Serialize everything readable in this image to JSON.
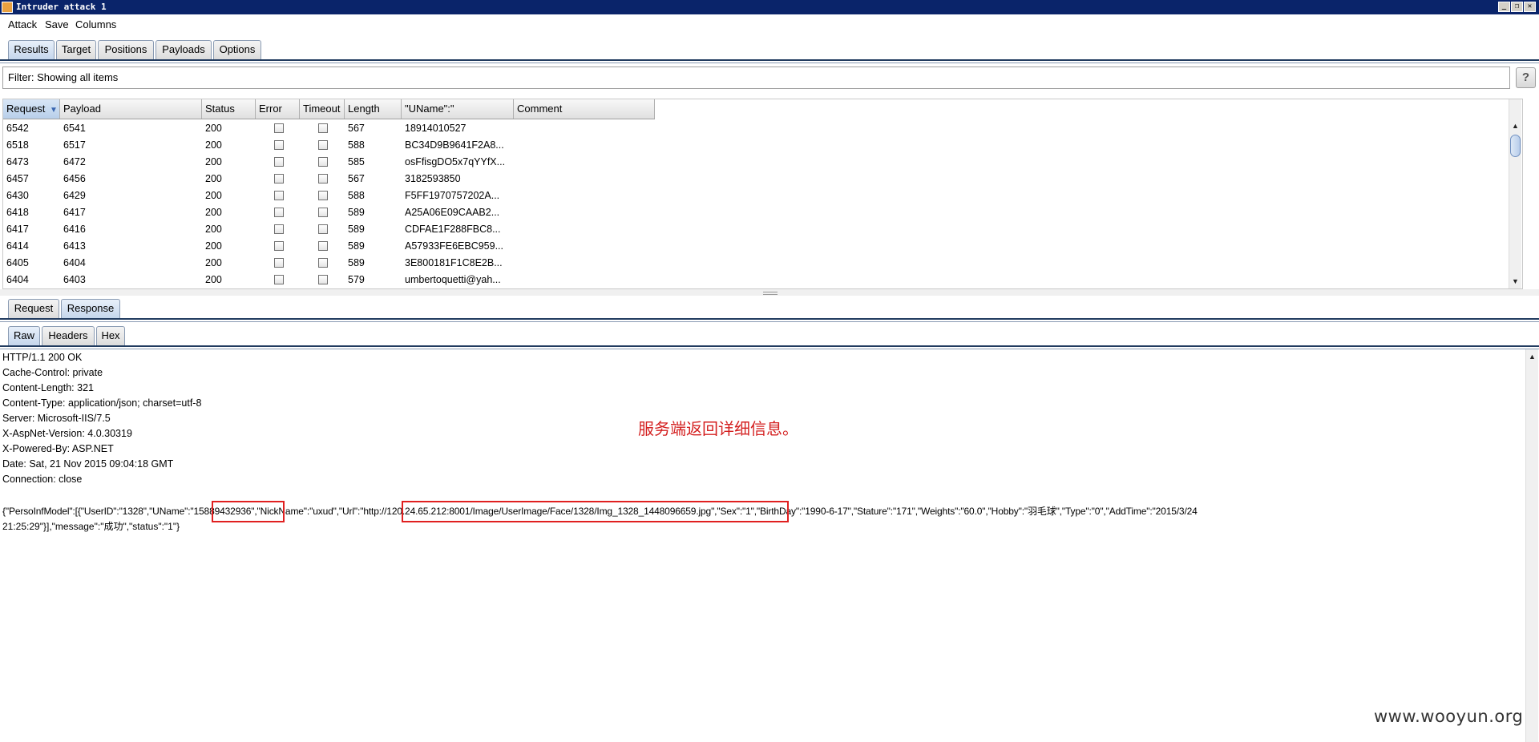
{
  "window": {
    "title": "Intruder attack 1",
    "controls": {
      "minimize": "_",
      "restore": "❐",
      "close": "✕"
    }
  },
  "menu": [
    "Attack",
    "Save",
    "Columns"
  ],
  "main_tabs": [
    "Results",
    "Target",
    "Positions",
    "Payloads",
    "Options"
  ],
  "filter": {
    "text": "Filter: Showing all items",
    "help": "?"
  },
  "table": {
    "columns": [
      "Request",
      "Payload",
      "Status",
      "Error",
      "Timeout",
      "Length",
      "\"UName\":\"",
      "Comment"
    ],
    "sort_indicator": "▼",
    "rows": [
      {
        "request": "6542",
        "payload": "6541",
        "status": "200",
        "length": "567",
        "uname": "18914010527"
      },
      {
        "request": "6518",
        "payload": "6517",
        "status": "200",
        "length": "588",
        "uname": "BC34D9B9641F2A8..."
      },
      {
        "request": "6473",
        "payload": "6472",
        "status": "200",
        "length": "585",
        "uname": "osFfisgDO5x7qYYfX..."
      },
      {
        "request": "6457",
        "payload": "6456",
        "status": "200",
        "length": "567",
        "uname": "3182593850"
      },
      {
        "request": "6430",
        "payload": "6429",
        "status": "200",
        "length": "588",
        "uname": "F5FF1970757202A..."
      },
      {
        "request": "6418",
        "payload": "6417",
        "status": "200",
        "length": "589",
        "uname": "A25A06E09CAAB2..."
      },
      {
        "request": "6417",
        "payload": "6416",
        "status": "200",
        "length": "589",
        "uname": "CDFAE1F288FBC8..."
      },
      {
        "request": "6414",
        "payload": "6413",
        "status": "200",
        "length": "589",
        "uname": "A57933FE6EBC959..."
      },
      {
        "request": "6405",
        "payload": "6404",
        "status": "200",
        "length": "589",
        "uname": "3E800181F1C8E2B..."
      },
      {
        "request": "6404",
        "payload": "6403",
        "status": "200",
        "length": "579",
        "uname": "umbertoquetti@yah..."
      }
    ]
  },
  "detail_tabs": [
    "Request",
    "Response"
  ],
  "view_tabs": [
    "Raw",
    "Headers",
    "Hex"
  ],
  "response": {
    "headers": [
      "HTTP/1.1 200 OK",
      "Cache-Control: private",
      "Content-Length: 321",
      "Content-Type: application/json; charset=utf-8",
      "Server: Microsoft-IIS/7.5",
      "X-AspNet-Version: 4.0.30319",
      "X-Powered-By: ASP.NET",
      "Date: Sat, 21 Nov 2015 09:04:18 GMT",
      "Connection: close"
    ],
    "body_line1": "{\"PersoInfModel\":[{\"UserID\":\"1328\",\"UName\":\"15889432936\",\"NickName\":\"uxud\",\"Url\":\"http://120.24.65.212:8001/Image/UserImage/Face/1328/Img_1328_1448096659.jpg\",\"Sex\":\"1\",\"BirthDay\":\"1990-6-17\",\"Stature\":\"171\",\"Weights\":\"60.0\",\"Hobby\":\"羽毛球\",\"Type\":\"0\",\"AddTime\":\"2015/3/24",
    "body_line2": "21:25:29\"}],\"message\":\"成功\",\"status\":\"1\"}"
  },
  "annotation": "服务端返回详细信息。",
  "watermark": "www.wooyun.org",
  "colors": {
    "titlebar": "#0a246a",
    "highlight": "#e02020",
    "annotation": "#d42020"
  }
}
